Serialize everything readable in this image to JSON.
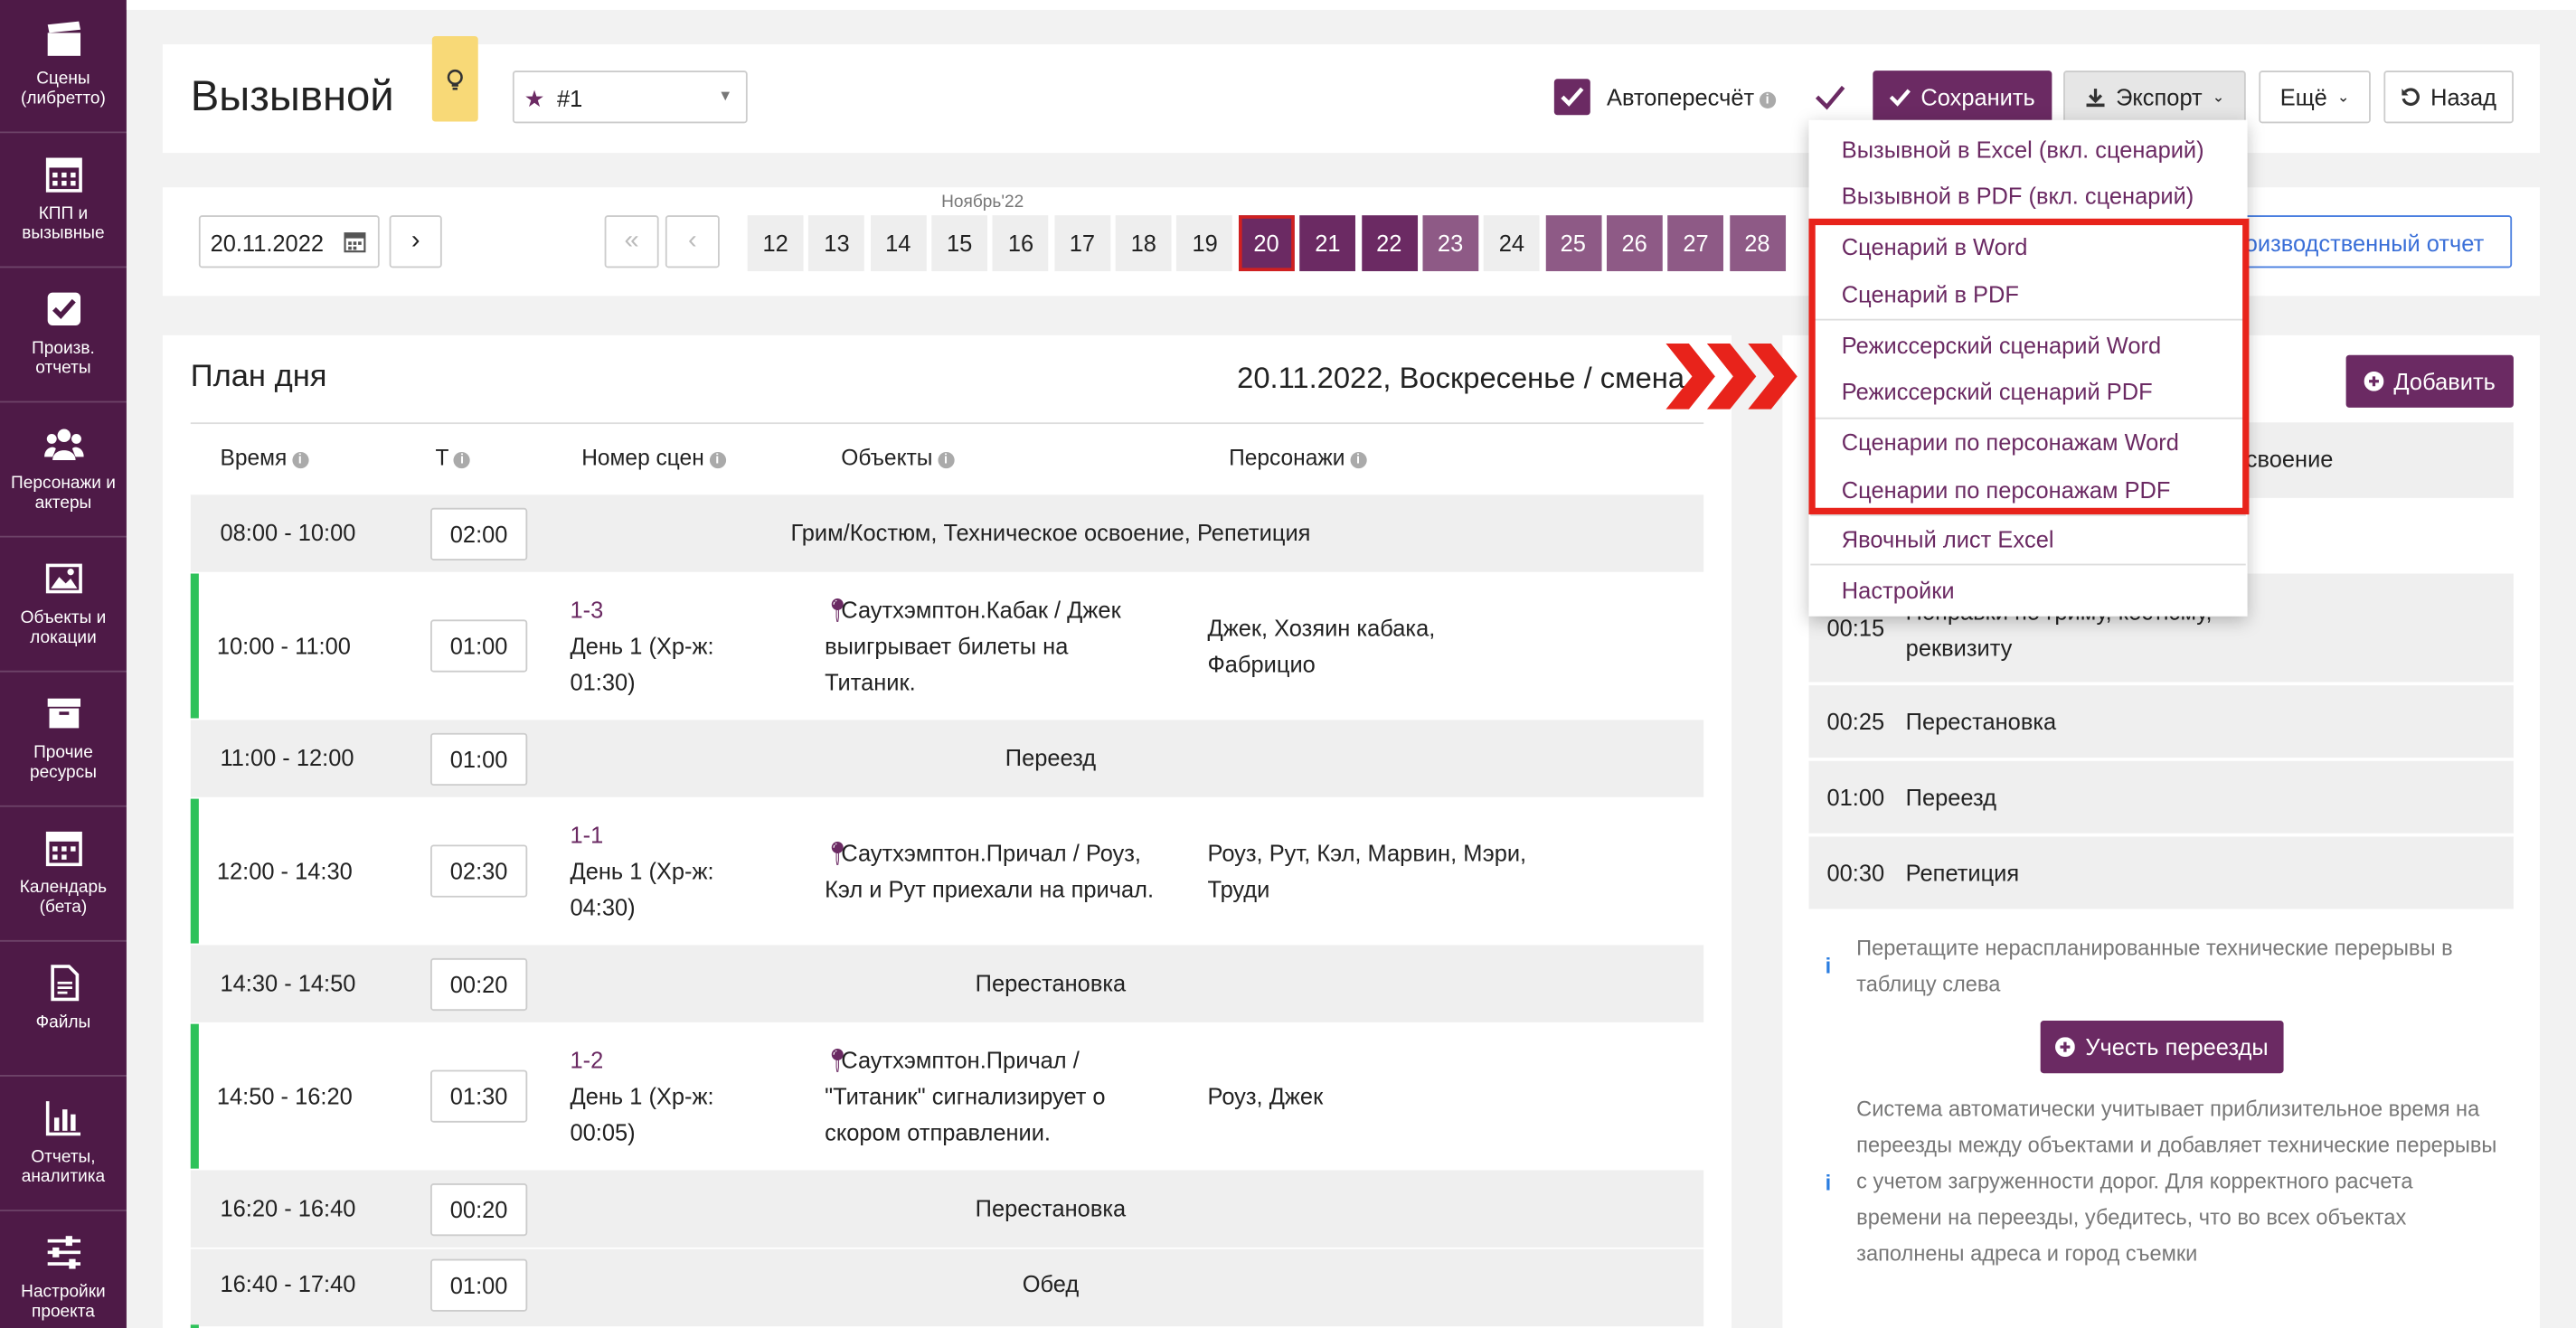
{
  "sidebar": {
    "items": [
      {
        "icon": "clapperboard-icon",
        "label": "Сцены (либретто)"
      },
      {
        "icon": "calendar-grid-icon",
        "label": "КПП и вызывные"
      },
      {
        "icon": "checkbox-icon",
        "label": "Произв. отчеты"
      },
      {
        "icon": "people-icon",
        "label": "Персонажи и актеры"
      },
      {
        "icon": "image-icon",
        "label": "Объекты и локации"
      },
      {
        "icon": "archive-box-icon",
        "label": "Прочие ресурсы"
      },
      {
        "icon": "calendar-icon",
        "label": "Календарь (бета)"
      },
      {
        "icon": "file-icon",
        "label": "Файлы"
      },
      {
        "icon": "bar-chart-icon",
        "label": "Отчеты, аналитика"
      },
      {
        "icon": "sliders-icon",
        "label": "Настройки проекта"
      }
    ]
  },
  "header": {
    "title": "Вызывной",
    "version_select": "#1",
    "autorecalc_label": "Автопересчёт",
    "save_label": "Сохранить",
    "export_label": "Экспорт",
    "more_label": "Ещё",
    "back_label": "Назад"
  },
  "date_bar": {
    "date_value": "20.11.2022",
    "month_label": "Ноябрь'22",
    "days": [
      "12",
      "13",
      "14",
      "15",
      "16",
      "17",
      "18",
      "19",
      "20",
      "21",
      "22",
      "23",
      "24",
      "25",
      "26",
      "27",
      "28"
    ],
    "report_button": "Производственный отчет"
  },
  "plan": {
    "title": "План дня",
    "date_heading": "20.11.2022, Воскресенье / смена",
    "columns": [
      "Время",
      "Т",
      "Номер сцен",
      "Объекты",
      "Персонажи"
    ],
    "rows": [
      {
        "time": "08:00 - 10:00",
        "dur": "02:00",
        "label": "Грим/Костюм, Техническое освоение, Репетиция"
      },
      {
        "time": "10:00 - 11:00",
        "dur": "01:00",
        "scene_no": "1-3",
        "scene_lines": [
          "День 1 (Хр-ж:",
          "01:30)"
        ],
        "object_lines": [
          "Саутхэмптон.Кабак / Джек",
          "выигрывает билеты на",
          "Титаник."
        ],
        "characters_lines": [
          "Джек, Хозяин кабака,",
          "Фабрицио"
        ]
      },
      {
        "time": "11:00 - 12:00",
        "dur": "01:00",
        "label": "Переезд"
      },
      {
        "time": "12:00 - 14:30",
        "dur": "02:30",
        "scene_no": "1-1",
        "scene_lines": [
          "День 1 (Хр-ж:",
          "04:30)"
        ],
        "object_lines": [
          "Саутхэмптон.Причал / Роуз,",
          "Кэл и Рут приехали на причал."
        ],
        "characters_lines": [
          "Роуз, Рут, Кэл, Марвин, Мэри,",
          "Труди"
        ]
      },
      {
        "time": "14:30 - 14:50",
        "dur": "00:20",
        "label": "Перестановка"
      },
      {
        "time": "14:50 - 16:20",
        "dur": "01:30",
        "scene_no": "1-2",
        "scene_lines": [
          "День 1 (Хр-ж:",
          "00:05)"
        ],
        "object_lines": [
          "Саутхэмптон.Причал /",
          "\"Титаник\" сигнализирует о",
          "скором отправлении."
        ],
        "characters_lines": [
          "Роуз, Джек"
        ]
      },
      {
        "time": "16:20 - 16:40",
        "dur": "00:20",
        "label": "Перестановка"
      },
      {
        "time": "16:40 - 17:40",
        "dur": "01:00",
        "label": "Обед"
      }
    ]
  },
  "right_panel": {
    "add_button": "Добавить",
    "col_name_fragment": "своение",
    "break_rows": [
      {
        "time": "00:15",
        "name_lines": [
          "Поправки по гриму, костюму,",
          "реквизиту"
        ]
      },
      {
        "time": "00:25",
        "name_lines": [
          "Перестановка"
        ]
      },
      {
        "time": "01:00",
        "name_lines": [
          "Переезд"
        ]
      },
      {
        "time": "00:30",
        "name_lines": [
          "Репетиция"
        ]
      }
    ],
    "hint1_lines": [
      "Перетащите нераспланированные технические перерывы в",
      "таблицу слева"
    ],
    "account_moves_button": "Учесть переезды",
    "hint2_lines": [
      "Система автоматически учитывает приблизительное время на",
      "переезды между объектами и добавляет технические перерывы",
      "с учетом загруженности дорог. Для корректного расчета",
      "времени на переезды, убедитесь, что во всех объектах",
      "заполнены адреса и город съемки"
    ]
  },
  "export_menu": {
    "items": [
      "Вызывной в Excel (вкл. сценарий)",
      "Вызывной в PDF (вкл. сценарий)",
      "Сценарий в Word",
      "Сценарий в PDF",
      "Режиссерский сценарий Word",
      "Режиссерский сценарий PDF",
      "Сценарии по персонажам Word",
      "Сценарии по персонажам PDF",
      "Явочный лист Excel",
      "Настройки"
    ]
  },
  "colors": {
    "sidebar": "#4e1a47",
    "accent": "#6b2a63",
    "highlight_box": "#e8231b",
    "scene_bar": "#2ec25a"
  }
}
